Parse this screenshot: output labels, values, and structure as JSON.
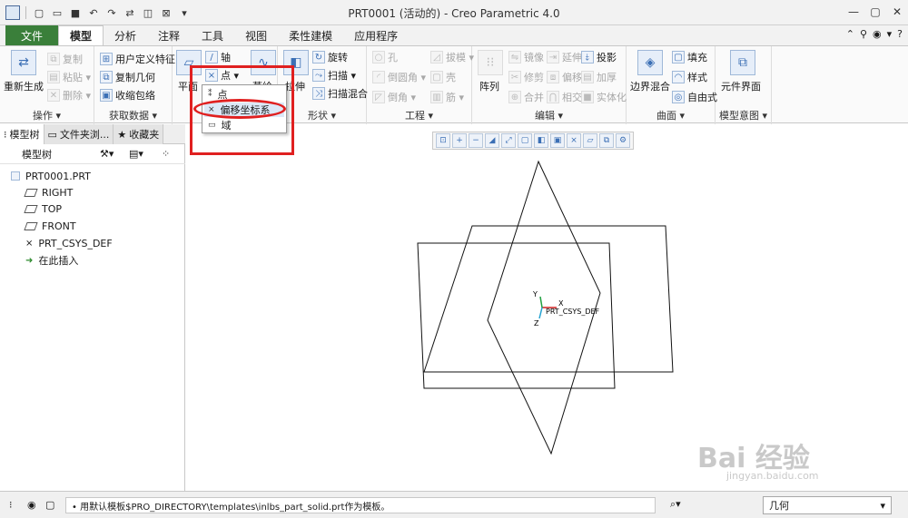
{
  "window": {
    "title": "PRT0001 (活动的) - Creo Parametric 4.0"
  },
  "tabs": [
    "文件",
    "模型",
    "分析",
    "注释",
    "工具",
    "视图",
    "柔性建模",
    "应用程序"
  ],
  "ribbon": {
    "operations": {
      "label": "操作 ▾",
      "regenerate": "重新生成",
      "copy": "复制",
      "paste": "粘贴 ▾",
      "delete": "删除 ▾"
    },
    "get_data": {
      "label": "获取数据 ▾",
      "udf": "用户定义特征",
      "copy_geom": "复制几何",
      "shrinkwrap": "收缩包络"
    },
    "datum": {
      "plane": "平面",
      "axis": "轴",
      "point": "点 ▾",
      "sketch": "草绘"
    },
    "shapes": {
      "label": "形状 ▾",
      "extrude": "拉伸",
      "revolve": "旋转",
      "sweep": "扫描 ▾",
      "swept_blend": "扫描混合"
    },
    "engineering": {
      "label": "工程 ▾",
      "hole": "孔",
      "round": "倒圆角 ▾",
      "chamfer": "倒角 ▾",
      "draft": "拔模 ▾",
      "shell": "壳",
      "rib": "筋 ▾"
    },
    "editing": {
      "label": "编辑 ▾",
      "pattern": "阵列",
      "mirror": "镜像",
      "modify": "修剪",
      "merge": "合并",
      "extend": "延伸",
      "offset": "偏移",
      "intersect": "相交",
      "project": "投影",
      "thicken": "加厚",
      "solidify": "实体化"
    },
    "surfaces": {
      "label": "曲面 ▾",
      "boundary_blend": "边界混合",
      "fill": "填充",
      "style": "样式",
      "freestyle": "自由式"
    },
    "model_intent": {
      "label": "模型意图 ▾",
      "component_interface": "元件界面"
    }
  },
  "dropdown": {
    "items": [
      "点",
      "偏移坐标系",
      "域"
    ]
  },
  "left_panel": {
    "tabs": [
      "模型树",
      "文件夹浏...",
      "收藏夹"
    ],
    "header": "模型树",
    "tree": [
      "PRT0001.PRT",
      "RIGHT",
      "TOP",
      "FRONT",
      "PRT_CSYS_DEF",
      "在此插入"
    ]
  },
  "graphics": {
    "csys_label": "PRT_CSYS_DEF",
    "axis_x": "X",
    "axis_y": "Y",
    "axis_z": "Z"
  },
  "status": {
    "message": "• 用默认模板$PRO_DIRECTORY\\templates\\inlbs_part_solid.prt作为模板。",
    "filter": "几何"
  },
  "watermark": {
    "brand": "Bai 经验",
    "url": "jingyan.baidu.com"
  },
  "colors": {
    "file_tab": "#3a7f3a",
    "highlight": "#e02020",
    "icon_blue": "#3b6fb5"
  }
}
